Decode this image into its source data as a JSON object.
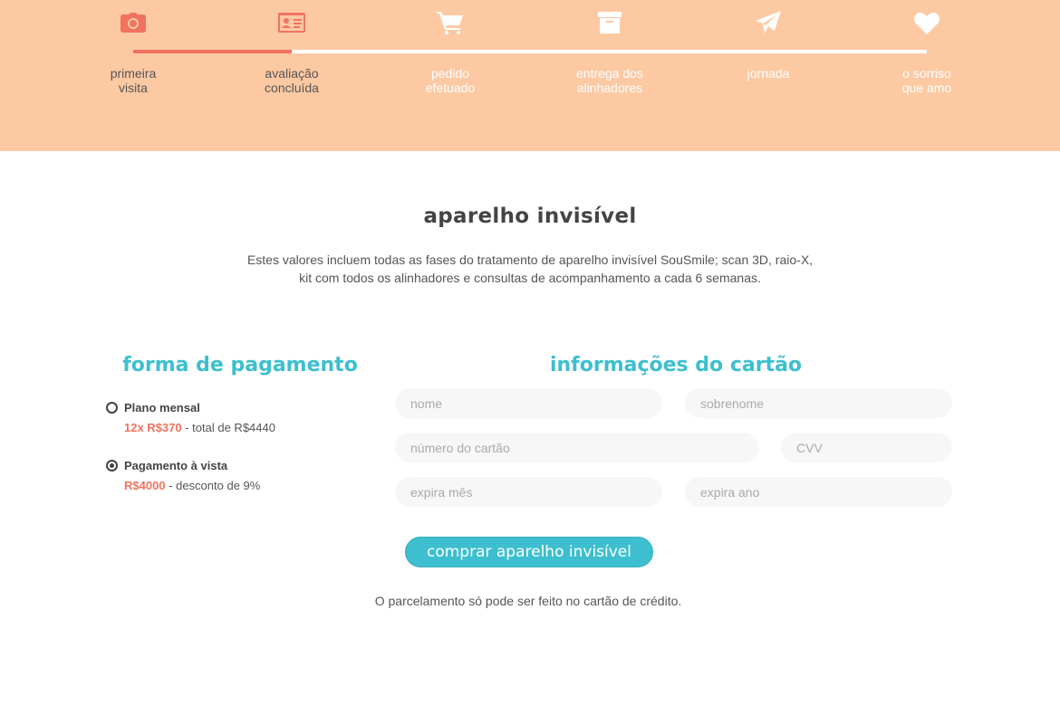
{
  "progress": {
    "fraction_complete": 0.2,
    "steps": [
      {
        "label": "primeira\nvisita",
        "icon": "camera-icon",
        "status": "done"
      },
      {
        "label": "avaliação\nconcluída",
        "icon": "id-card-icon",
        "status": "done"
      },
      {
        "label": "pedido\nefetuado",
        "icon": "cart-icon",
        "status": "todo"
      },
      {
        "label": "entrega dos\nalinhadores",
        "icon": "archive-box-icon",
        "status": "todo"
      },
      {
        "label": "jornada",
        "icon": "paper-plane-icon",
        "status": "todo"
      },
      {
        "label": "o sorriso\nque amo",
        "icon": "heart-icon",
        "status": "todo"
      }
    ]
  },
  "main": {
    "title": "aparelho invisível",
    "description_line1": "Estes valores incluem todas as fases do tratamento de aparelho invisível SouSmile; scan 3D, raio-X,",
    "description_line2": "kit com todos os alinhadores e consultas de acompanhamento a cada 6 semanas."
  },
  "payment": {
    "heading": "forma de pagamento",
    "options": [
      {
        "name": "Plano mensal",
        "highlight": "12x R$370",
        "detail": " - total de R$4440",
        "selected": false
      },
      {
        "name": "Pagamento à vista",
        "highlight": "R$4000",
        "detail": " - desconto de 9%",
        "selected": true
      }
    ]
  },
  "card": {
    "heading": "informações do cartão",
    "first_name_placeholder": "nome",
    "last_name_placeholder": "sobrenome",
    "number_placeholder": "número do cartão",
    "cvv_placeholder": "CVV",
    "exp_month_placeholder": "expira mês",
    "exp_year_placeholder": "expira ano"
  },
  "buy_button_label": "comprar aparelho invisível",
  "footer_note": "O parcelamento só pode ser feito no cartão de crédito.",
  "colors": {
    "banner": "#fdc9a3",
    "accent_coral": "#f0735f",
    "accent_teal": "#3dbfcf",
    "field_bg": "#f7f7f7"
  }
}
